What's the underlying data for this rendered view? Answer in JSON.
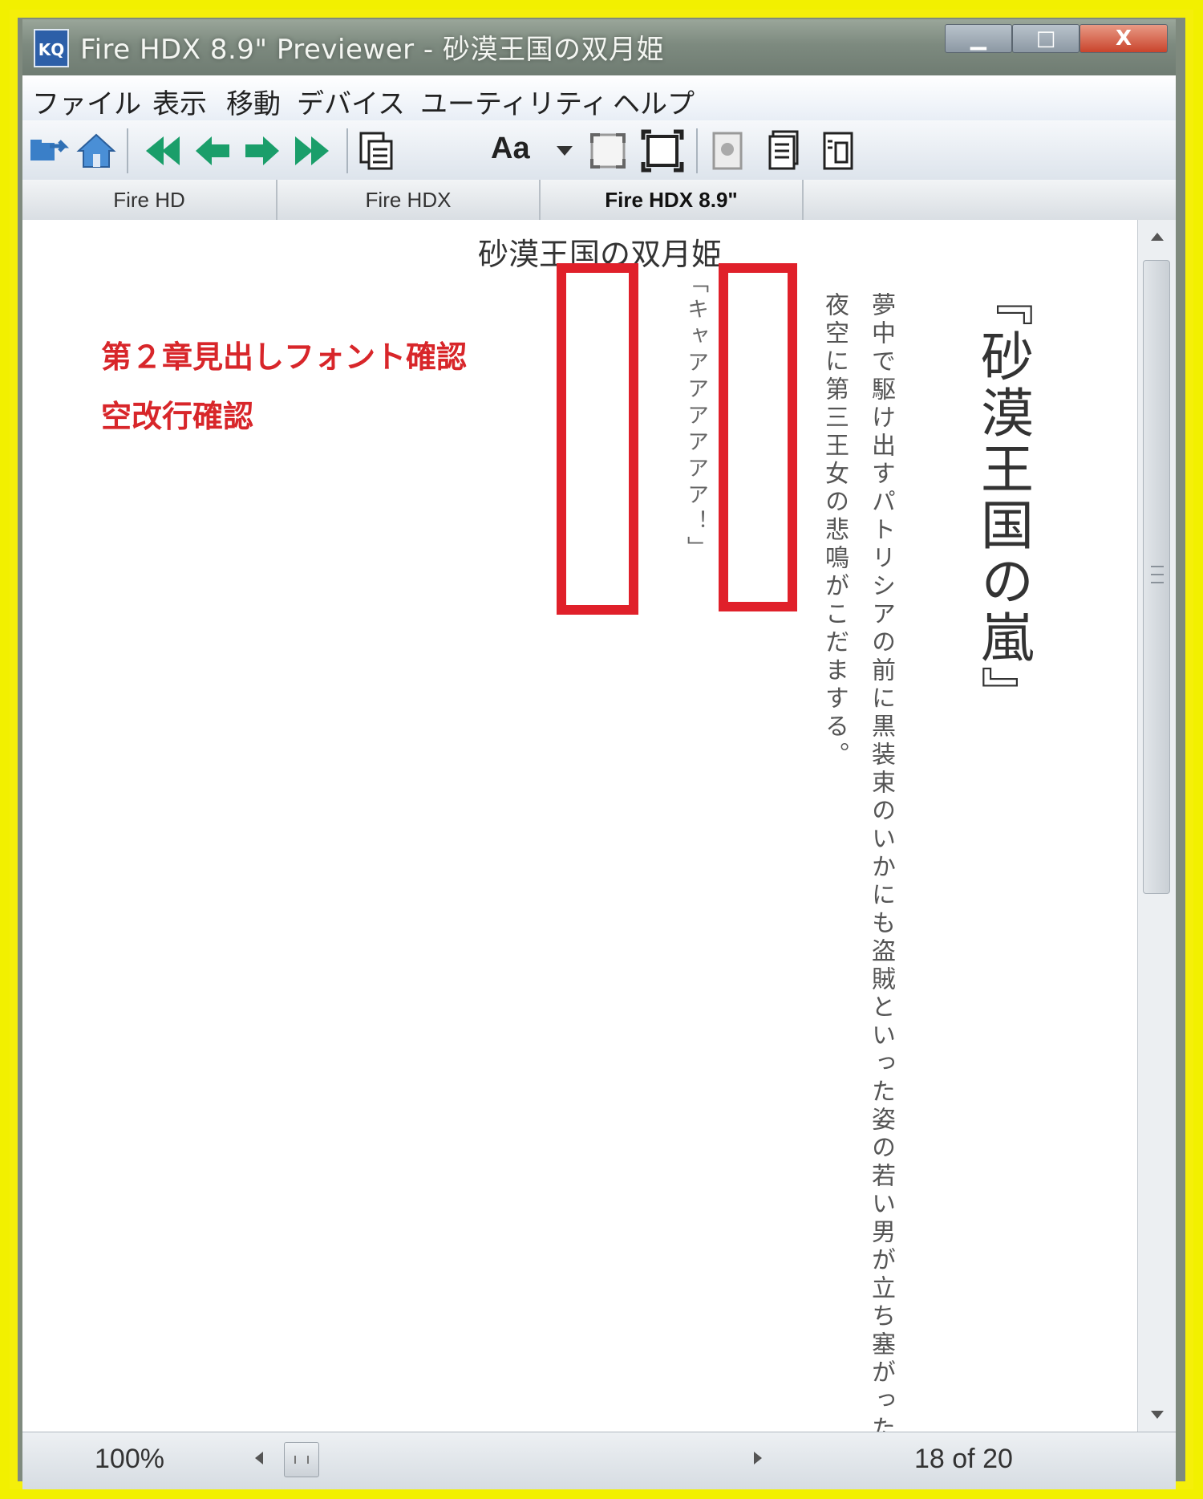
{
  "window": {
    "title": "Fire HDX 8.9\" Previewer - 砂漠王国の双月姫",
    "app_icon_text": "KQ",
    "minimize_label": "▁",
    "maximize_label": "□",
    "close_label": "X"
  },
  "menu": {
    "items": [
      "ファイル",
      "表示",
      "移動",
      "デバイス",
      "ユーティリティ",
      "ヘルプ"
    ]
  },
  "toolbar": {
    "icons": [
      "open-icon",
      "home-icon",
      "first-page-icon",
      "previous-page-icon",
      "next-page-icon",
      "last-page-icon",
      "document-icon",
      "font-icon",
      "fit-page-icon",
      "full-screen-icon",
      "page-icon",
      "single-page-icon",
      "two-page-icon"
    ],
    "font_label": "Aa"
  },
  "tabs": [
    {
      "label": "Fire HD",
      "active": false
    },
    {
      "label": "Fire HDX",
      "active": false
    },
    {
      "label": "Fire HDX 8.9\"",
      "active": true
    }
  ],
  "content": {
    "book_title": "砂漠王国の双月姫",
    "notes": [
      "第２章見出しフォント確認",
      "空改行確認"
    ],
    "chapter_title": "『砂漠王国の嵐』",
    "body_lines": [
      "夢中で駆け出すパトリシアの前に黒装束のいかにも盗賊といった姿の若い男が立ち塞がった。",
      "夜空に第三王女の悲鳴がこだまする。"
    ],
    "dialogue": "「キャアアアアアア！」"
  },
  "status": {
    "zoom": "100%",
    "page": "18 of 20"
  },
  "colors": {
    "frame": "#f5ef0a",
    "note_red": "#d8262a",
    "box_red": "#e0202a",
    "toolbar_green": "#1a9e6a"
  }
}
